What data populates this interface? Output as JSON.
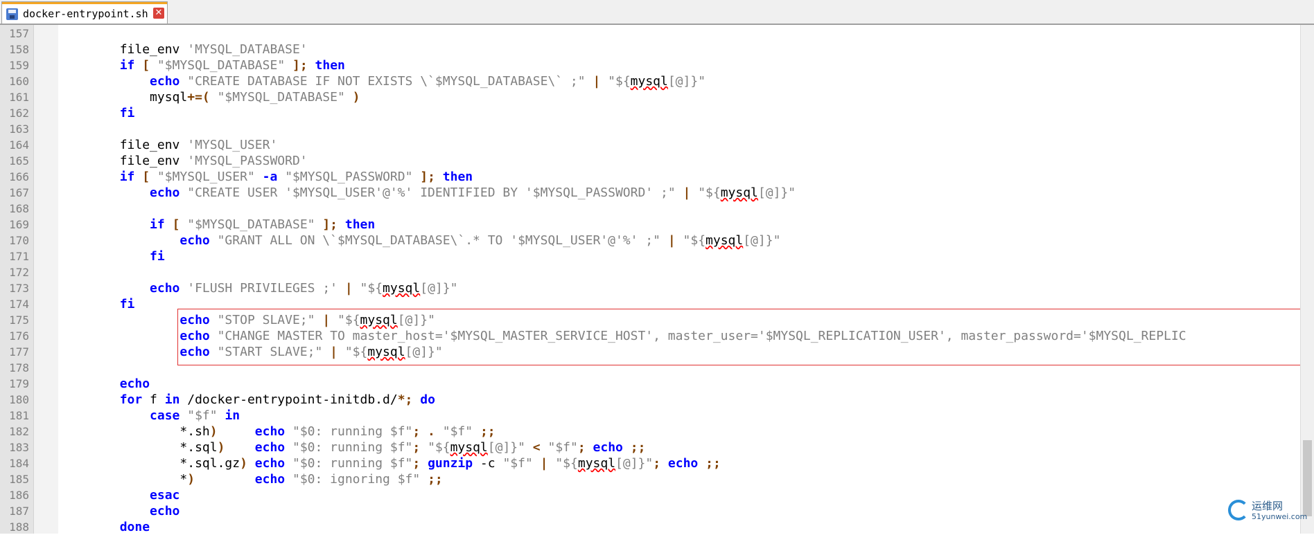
{
  "tab": {
    "title": "docker-entrypoint.sh",
    "icon": "save-icon",
    "close_icon": "close-icon"
  },
  "editor": {
    "lines": [
      {
        "number": "157",
        "segments": []
      },
      {
        "number": "158",
        "segments": [
          {
            "text": "        file_env ",
            "style": "plain"
          },
          {
            "text": "'MYSQL_DATABASE'",
            "style": "string"
          }
        ]
      },
      {
        "number": "159",
        "segments": [
          {
            "text": "        ",
            "style": "plain"
          },
          {
            "text": "if",
            "style": "keyword"
          },
          {
            "text": " ",
            "style": "plain"
          },
          {
            "text": "[",
            "style": "operator"
          },
          {
            "text": " ",
            "style": "plain"
          },
          {
            "text": "\"$MYSQL_DATABASE\"",
            "style": "string"
          },
          {
            "text": " ",
            "style": "plain"
          },
          {
            "text": "];",
            "style": "operator"
          },
          {
            "text": " ",
            "style": "plain"
          },
          {
            "text": "then",
            "style": "keyword"
          }
        ]
      },
      {
        "number": "160",
        "segments": [
          {
            "text": "            ",
            "style": "plain"
          },
          {
            "text": "echo",
            "style": "keyword"
          },
          {
            "text": " ",
            "style": "plain"
          },
          {
            "text": "\"CREATE DATABASE IF NOT EXISTS \\`$MYSQL_DATABASE\\` ;\"",
            "style": "string"
          },
          {
            "text": " ",
            "style": "plain"
          },
          {
            "text": "|",
            "style": "operator"
          },
          {
            "text": " ",
            "style": "plain"
          },
          {
            "text": "\"${",
            "style": "string"
          },
          {
            "text": "mysql",
            "style": "squiggle"
          },
          {
            "text": "[@]}\"",
            "style": "string"
          }
        ]
      },
      {
        "number": "161",
        "segments": [
          {
            "text": "            mysql",
            "style": "plain"
          },
          {
            "text": "+=(",
            "style": "operator"
          },
          {
            "text": " ",
            "style": "plain"
          },
          {
            "text": "\"$MYSQL_DATABASE\"",
            "style": "string"
          },
          {
            "text": " ",
            "style": "plain"
          },
          {
            "text": ")",
            "style": "operator"
          }
        ]
      },
      {
        "number": "162",
        "segments": [
          {
            "text": "        ",
            "style": "plain"
          },
          {
            "text": "fi",
            "style": "keyword"
          }
        ]
      },
      {
        "number": "163",
        "segments": []
      },
      {
        "number": "164",
        "segments": [
          {
            "text": "        file_env ",
            "style": "plain"
          },
          {
            "text": "'MYSQL_USER'",
            "style": "string"
          }
        ]
      },
      {
        "number": "165",
        "segments": [
          {
            "text": "        file_env ",
            "style": "plain"
          },
          {
            "text": "'MYSQL_PASSWORD'",
            "style": "string"
          }
        ]
      },
      {
        "number": "166",
        "segments": [
          {
            "text": "        ",
            "style": "plain"
          },
          {
            "text": "if",
            "style": "keyword"
          },
          {
            "text": " ",
            "style": "plain"
          },
          {
            "text": "[",
            "style": "operator"
          },
          {
            "text": " ",
            "style": "plain"
          },
          {
            "text": "\"$MYSQL_USER\"",
            "style": "string"
          },
          {
            "text": " ",
            "style": "plain"
          },
          {
            "text": "-a",
            "style": "keyword"
          },
          {
            "text": " ",
            "style": "plain"
          },
          {
            "text": "\"$MYSQL_PASSWORD\"",
            "style": "string"
          },
          {
            "text": " ",
            "style": "plain"
          },
          {
            "text": "];",
            "style": "operator"
          },
          {
            "text": " ",
            "style": "plain"
          },
          {
            "text": "then",
            "style": "keyword"
          }
        ]
      },
      {
        "number": "167",
        "segments": [
          {
            "text": "            ",
            "style": "plain"
          },
          {
            "text": "echo",
            "style": "keyword"
          },
          {
            "text": " ",
            "style": "plain"
          },
          {
            "text": "\"CREATE USER '$MYSQL_USER'@'%' IDENTIFIED BY '$MYSQL_PASSWORD' ;\"",
            "style": "string"
          },
          {
            "text": " ",
            "style": "plain"
          },
          {
            "text": "|",
            "style": "operator"
          },
          {
            "text": " ",
            "style": "plain"
          },
          {
            "text": "\"${",
            "style": "string"
          },
          {
            "text": "mysql",
            "style": "squiggle"
          },
          {
            "text": "[@]}\"",
            "style": "string"
          }
        ]
      },
      {
        "number": "168",
        "segments": []
      },
      {
        "number": "169",
        "segments": [
          {
            "text": "            ",
            "style": "plain"
          },
          {
            "text": "if",
            "style": "keyword"
          },
          {
            "text": " ",
            "style": "plain"
          },
          {
            "text": "[",
            "style": "operator"
          },
          {
            "text": " ",
            "style": "plain"
          },
          {
            "text": "\"$MYSQL_DATABASE\"",
            "style": "string"
          },
          {
            "text": " ",
            "style": "plain"
          },
          {
            "text": "];",
            "style": "operator"
          },
          {
            "text": " ",
            "style": "plain"
          },
          {
            "text": "then",
            "style": "keyword"
          }
        ]
      },
      {
        "number": "170",
        "segments": [
          {
            "text": "                ",
            "style": "plain"
          },
          {
            "text": "echo",
            "style": "keyword"
          },
          {
            "text": " ",
            "style": "plain"
          },
          {
            "text": "\"GRANT ALL ON \\`$MYSQL_DATABASE\\`.* TO '$MYSQL_USER'@'%' ;\"",
            "style": "string"
          },
          {
            "text": " ",
            "style": "plain"
          },
          {
            "text": "|",
            "style": "operator"
          },
          {
            "text": " ",
            "style": "plain"
          },
          {
            "text": "\"${",
            "style": "string"
          },
          {
            "text": "mysql",
            "style": "squiggle"
          },
          {
            "text": "[@]}\"",
            "style": "string"
          }
        ]
      },
      {
        "number": "171",
        "segments": [
          {
            "text": "            ",
            "style": "plain"
          },
          {
            "text": "fi",
            "style": "keyword"
          }
        ]
      },
      {
        "number": "172",
        "segments": []
      },
      {
        "number": "173",
        "segments": [
          {
            "text": "            ",
            "style": "plain"
          },
          {
            "text": "echo",
            "style": "keyword"
          },
          {
            "text": " ",
            "style": "plain"
          },
          {
            "text": "'FLUSH PRIVILEGES ;'",
            "style": "string"
          },
          {
            "text": " ",
            "style": "plain"
          },
          {
            "text": "|",
            "style": "operator"
          },
          {
            "text": " ",
            "style": "plain"
          },
          {
            "text": "\"${",
            "style": "string"
          },
          {
            "text": "mysql",
            "style": "squiggle"
          },
          {
            "text": "[@]}\"",
            "style": "string"
          }
        ]
      },
      {
        "number": "174",
        "segments": [
          {
            "text": "        ",
            "style": "plain"
          },
          {
            "text": "fi",
            "style": "keyword"
          }
        ]
      },
      {
        "number": "175",
        "segments": [
          {
            "text": "                ",
            "style": "plain"
          },
          {
            "text": "echo",
            "style": "keyword"
          },
          {
            "text": " ",
            "style": "plain"
          },
          {
            "text": "\"STOP SLAVE;\"",
            "style": "string"
          },
          {
            "text": " ",
            "style": "plain"
          },
          {
            "text": "|",
            "style": "operator"
          },
          {
            "text": " ",
            "style": "plain"
          },
          {
            "text": "\"${",
            "style": "string"
          },
          {
            "text": "mysql",
            "style": "squiggle"
          },
          {
            "text": "[@]}\"",
            "style": "string"
          }
        ]
      },
      {
        "number": "176",
        "segments": [
          {
            "text": "                ",
            "style": "plain"
          },
          {
            "text": "echo",
            "style": "keyword"
          },
          {
            "text": " ",
            "style": "plain"
          },
          {
            "text": "\"CHANGE MASTER TO master_host='$MYSQL_MASTER_SERVICE_HOST', master_user='$MYSQL_REPLICATION_USER', master_password='$MYSQL_REPLIC",
            "style": "string"
          }
        ]
      },
      {
        "number": "177",
        "segments": [
          {
            "text": "                ",
            "style": "plain"
          },
          {
            "text": "echo",
            "style": "keyword"
          },
          {
            "text": " ",
            "style": "plain"
          },
          {
            "text": "\"START SLAVE;\"",
            "style": "string"
          },
          {
            "text": " ",
            "style": "plain"
          },
          {
            "text": "|",
            "style": "operator"
          },
          {
            "text": " ",
            "style": "plain"
          },
          {
            "text": "\"${",
            "style": "string"
          },
          {
            "text": "mysql",
            "style": "squiggle"
          },
          {
            "text": "[@]}\"",
            "style": "string"
          }
        ]
      },
      {
        "number": "178",
        "segments": []
      },
      {
        "number": "179",
        "segments": [
          {
            "text": "        ",
            "style": "plain"
          },
          {
            "text": "echo",
            "style": "keyword"
          }
        ]
      },
      {
        "number": "180",
        "segments": [
          {
            "text": "        ",
            "style": "plain"
          },
          {
            "text": "for",
            "style": "keyword"
          },
          {
            "text": " f ",
            "style": "plain"
          },
          {
            "text": "in",
            "style": "keyword"
          },
          {
            "text": " /docker-entrypoint-initdb.d/",
            "style": "plain"
          },
          {
            "text": "*;",
            "style": "operator"
          },
          {
            "text": " ",
            "style": "plain"
          },
          {
            "text": "do",
            "style": "keyword"
          }
        ]
      },
      {
        "number": "181",
        "segments": [
          {
            "text": "            ",
            "style": "plain"
          },
          {
            "text": "case",
            "style": "keyword"
          },
          {
            "text": " ",
            "style": "plain"
          },
          {
            "text": "\"$f\"",
            "style": "string"
          },
          {
            "text": " ",
            "style": "plain"
          },
          {
            "text": "in",
            "style": "keyword"
          }
        ]
      },
      {
        "number": "182",
        "segments": [
          {
            "text": "                *.sh",
            "style": "plain"
          },
          {
            "text": ")",
            "style": "operator"
          },
          {
            "text": "     ",
            "style": "plain"
          },
          {
            "text": "echo",
            "style": "keyword"
          },
          {
            "text": " ",
            "style": "plain"
          },
          {
            "text": "\"$0: running $f\"",
            "style": "string"
          },
          {
            "text": "; . ",
            "style": "operator"
          },
          {
            "text": "\"$f\"",
            "style": "string"
          },
          {
            "text": " ",
            "style": "plain"
          },
          {
            "text": ";;",
            "style": "operator"
          }
        ]
      },
      {
        "number": "183",
        "segments": [
          {
            "text": "                *.sql",
            "style": "plain"
          },
          {
            "text": ")",
            "style": "operator"
          },
          {
            "text": "    ",
            "style": "plain"
          },
          {
            "text": "echo",
            "style": "keyword"
          },
          {
            "text": " ",
            "style": "plain"
          },
          {
            "text": "\"$0: running $f\"",
            "style": "string"
          },
          {
            "text": "; ",
            "style": "operator"
          },
          {
            "text": "\"${",
            "style": "string"
          },
          {
            "text": "mysql",
            "style": "squiggle"
          },
          {
            "text": "[@]}\"",
            "style": "string"
          },
          {
            "text": " ",
            "style": "plain"
          },
          {
            "text": "<",
            "style": "operator"
          },
          {
            "text": " ",
            "style": "plain"
          },
          {
            "text": "\"$f\"",
            "style": "string"
          },
          {
            "text": "; ",
            "style": "operator"
          },
          {
            "text": "echo",
            "style": "keyword"
          },
          {
            "text": " ",
            "style": "plain"
          },
          {
            "text": ";;",
            "style": "operator"
          }
        ]
      },
      {
        "number": "184",
        "segments": [
          {
            "text": "                *.sql.gz",
            "style": "plain"
          },
          {
            "text": ")",
            "style": "operator"
          },
          {
            "text": " ",
            "style": "plain"
          },
          {
            "text": "echo",
            "style": "keyword"
          },
          {
            "text": " ",
            "style": "plain"
          },
          {
            "text": "\"$0: running $f\"",
            "style": "string"
          },
          {
            "text": "; ",
            "style": "operator"
          },
          {
            "text": "gunzip",
            "style": "keyword"
          },
          {
            "text": " -c ",
            "style": "plain"
          },
          {
            "text": "\"$f\"",
            "style": "string"
          },
          {
            "text": " ",
            "style": "plain"
          },
          {
            "text": "|",
            "style": "operator"
          },
          {
            "text": " ",
            "style": "plain"
          },
          {
            "text": "\"${",
            "style": "string"
          },
          {
            "text": "mysql",
            "style": "squiggle"
          },
          {
            "text": "[@]}\"",
            "style": "string"
          },
          {
            "text": "; ",
            "style": "operator"
          },
          {
            "text": "echo",
            "style": "keyword"
          },
          {
            "text": " ",
            "style": "plain"
          },
          {
            "text": ";;",
            "style": "operator"
          }
        ]
      },
      {
        "number": "185",
        "segments": [
          {
            "text": "                *",
            "style": "plain"
          },
          {
            "text": ")",
            "style": "operator"
          },
          {
            "text": "        ",
            "style": "plain"
          },
          {
            "text": "echo",
            "style": "keyword"
          },
          {
            "text": " ",
            "style": "plain"
          },
          {
            "text": "\"$0: ignoring $f\"",
            "style": "string"
          },
          {
            "text": " ",
            "style": "plain"
          },
          {
            "text": ";;",
            "style": "operator"
          }
        ]
      },
      {
        "number": "186",
        "segments": [
          {
            "text": "            ",
            "style": "plain"
          },
          {
            "text": "esac",
            "style": "keyword"
          }
        ]
      },
      {
        "number": "187",
        "segments": [
          {
            "text": "            ",
            "style": "plain"
          },
          {
            "text": "echo",
            "style": "keyword"
          }
        ]
      },
      {
        "number": "188",
        "segments": [
          {
            "text": "        ",
            "style": "plain"
          },
          {
            "text": "done",
            "style": "keyword"
          }
        ]
      }
    ]
  },
  "watermark": {
    "title": "运维网",
    "subtitle": "51yunwei.com"
  },
  "colors": {
    "keyword": "#0000ff",
    "string": "#808080",
    "operator": "#804000",
    "highlight_border": "#e03030",
    "squiggle": "#ff0000"
  }
}
